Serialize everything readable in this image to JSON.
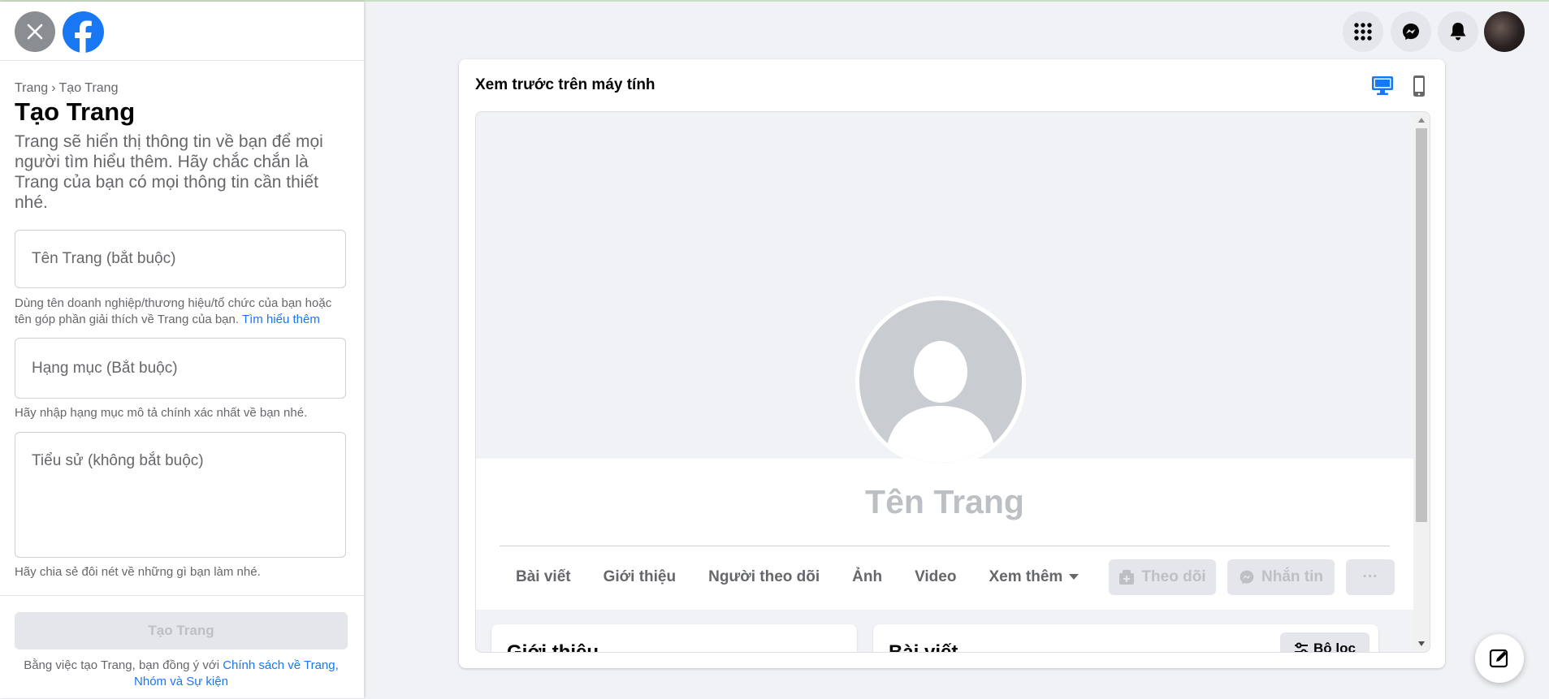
{
  "sidebar": {
    "breadcrumb": {
      "parent": "Trang",
      "separator": "›",
      "current": "Tạo Trang"
    },
    "title": "Tạo Trang",
    "description": "Trang sẽ hiển thị thông tin về bạn để mọi người tìm hiểu thêm. Hãy chắc chắn là Trang của bạn có mọi thông tin cần thiết nhé.",
    "name_field": {
      "placeholder": "Tên Trang (bắt buộc)",
      "value": "",
      "hint": "Dùng tên doanh nghiệp/thương hiệu/tổ chức của bạn hoặc tên góp phần giải thích về Trang của bạn.",
      "hint_link": "Tìm hiểu thêm"
    },
    "category_field": {
      "placeholder": "Hạng mục (Bắt buộc)",
      "value": "",
      "hint": "Hãy nhập hạng mục mô tả chính xác nhất về bạn nhé."
    },
    "bio_field": {
      "placeholder": "Tiểu sử (không bắt buộc)",
      "value": "",
      "hint": "Hãy chia sẻ đôi nét về những gì bạn làm nhé."
    },
    "create_button": "Tạo Trang",
    "terms_prefix": "Bằng việc tạo Trang, bạn đồng ý với",
    "terms_link": "Chính sách về Trang, Nhóm và Sự kiện"
  },
  "preview": {
    "title": "Xem trước trên máy tính",
    "page_name": "Tên Trang",
    "tabs": [
      {
        "label": "Bài viết"
      },
      {
        "label": "Giới thiệu"
      },
      {
        "label": "Người theo dõi"
      },
      {
        "label": "Ảnh"
      },
      {
        "label": "Video"
      },
      {
        "label": "Xem thêm"
      }
    ],
    "follow_button": "Theo dõi",
    "message_button": "Nhắn tin",
    "more_button": "···",
    "about_card_title": "Giới thiệu",
    "posts_card_title": "Bài viết",
    "filter_button": "Bộ lọc"
  },
  "colors": {
    "brand": "#1877f2",
    "page_bg": "#f0f2f5",
    "muted_text": "#65676b",
    "disabled_text": "#bcc0c4",
    "disabled_bg": "#e4e6eb"
  },
  "icons": {
    "close": "close-icon",
    "logo": "facebook-logo-icon",
    "menu": "grid-menu-icon",
    "messenger": "messenger-icon",
    "notifications": "bell-icon",
    "desktop_view": "desktop-icon",
    "mobile_view": "mobile-icon",
    "compose": "compose-icon"
  }
}
